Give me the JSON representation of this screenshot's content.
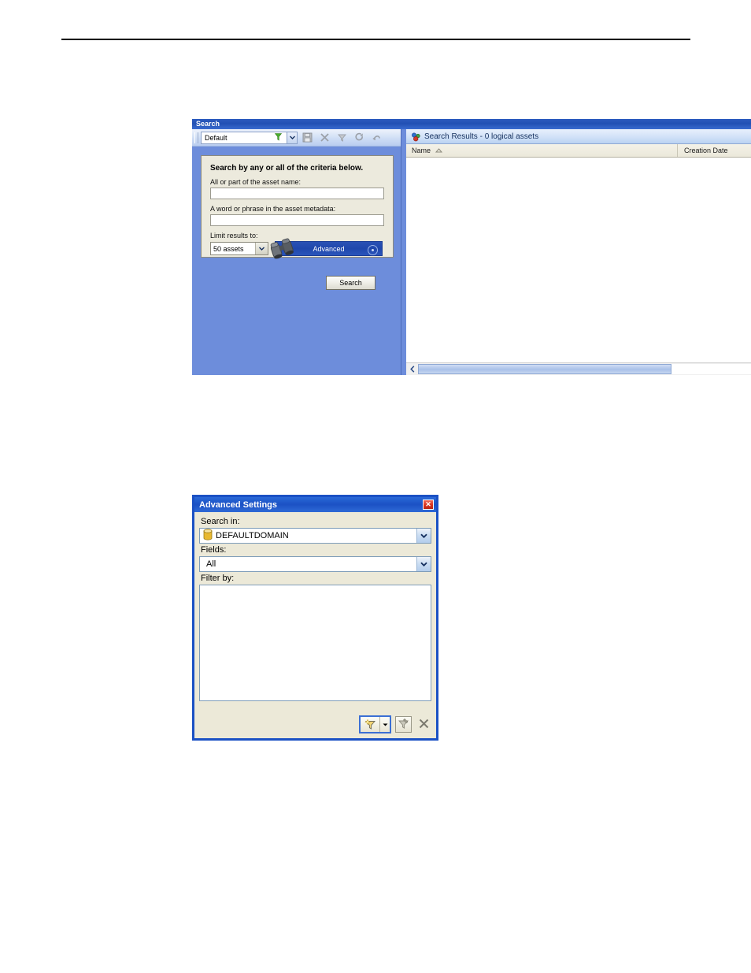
{
  "search_window": {
    "title": "Search",
    "toolbar": {
      "preset_value": "Default",
      "preset_icon": "funnel-icon",
      "dropdown_icon": "chevron-down-icon",
      "buttons": [
        {
          "name": "save-search-button",
          "icon": "floppy-disk-icon"
        },
        {
          "name": "delete-search-button",
          "icon": "x-icon"
        },
        {
          "name": "filter-button",
          "icon": "funnel-icon"
        },
        {
          "name": "refresh-button",
          "icon": "refresh-icon"
        },
        {
          "name": "undo-button",
          "icon": "undo-arrow-icon"
        }
      ]
    },
    "criteria": {
      "heading": "Search by any or all of the criteria below.",
      "name_label": "All or part of the asset name:",
      "name_value": "",
      "metadata_label": "A word or phrase in the asset metadata:",
      "metadata_value": "",
      "limit_label": "Limit results to:",
      "limit_value": "50 assets",
      "advanced_label": "Advanced",
      "advanced_icon": "binoculars-icon"
    },
    "search_button_label": "Search",
    "results": {
      "header_icon": "search-results-icon",
      "header_title": "Search Results - 0 logical assets",
      "columns": [
        {
          "label": "Name",
          "sort_icon": "sort-ascending-icon"
        },
        {
          "label": "Creation Date",
          "sort_icon": ""
        }
      ],
      "rows": [],
      "scroll_left_icon": "chevron-left-icon"
    }
  },
  "advanced_dialog": {
    "title": "Advanced Settings",
    "close_icon": "close-icon",
    "search_in_label": "Search in:",
    "search_in_value": "DEFAULTDOMAIN",
    "search_in_icon": "database-cylinder-icon",
    "fields_label": "Fields:",
    "fields_value": "All",
    "filter_by_label": "Filter by:",
    "filter_items": [],
    "footer": {
      "new_filter_icon": "new-filter-funnel-icon",
      "new_filter_dropdown_icon": "chevron-down-icon",
      "edit_filter_icon": "edit-filter-funnel-icon",
      "remove_filter_icon": "x-icon"
    }
  },
  "colors": {
    "panel_blue": "#6d8ddb",
    "title_blue": "#1b51c4",
    "advanced_button_blue": "#2250b4",
    "criteria_beige": "#eceadd",
    "dialog_face": "#ece9d8",
    "close_red": "#d8341f",
    "db_yellow": "#e8b830"
  }
}
